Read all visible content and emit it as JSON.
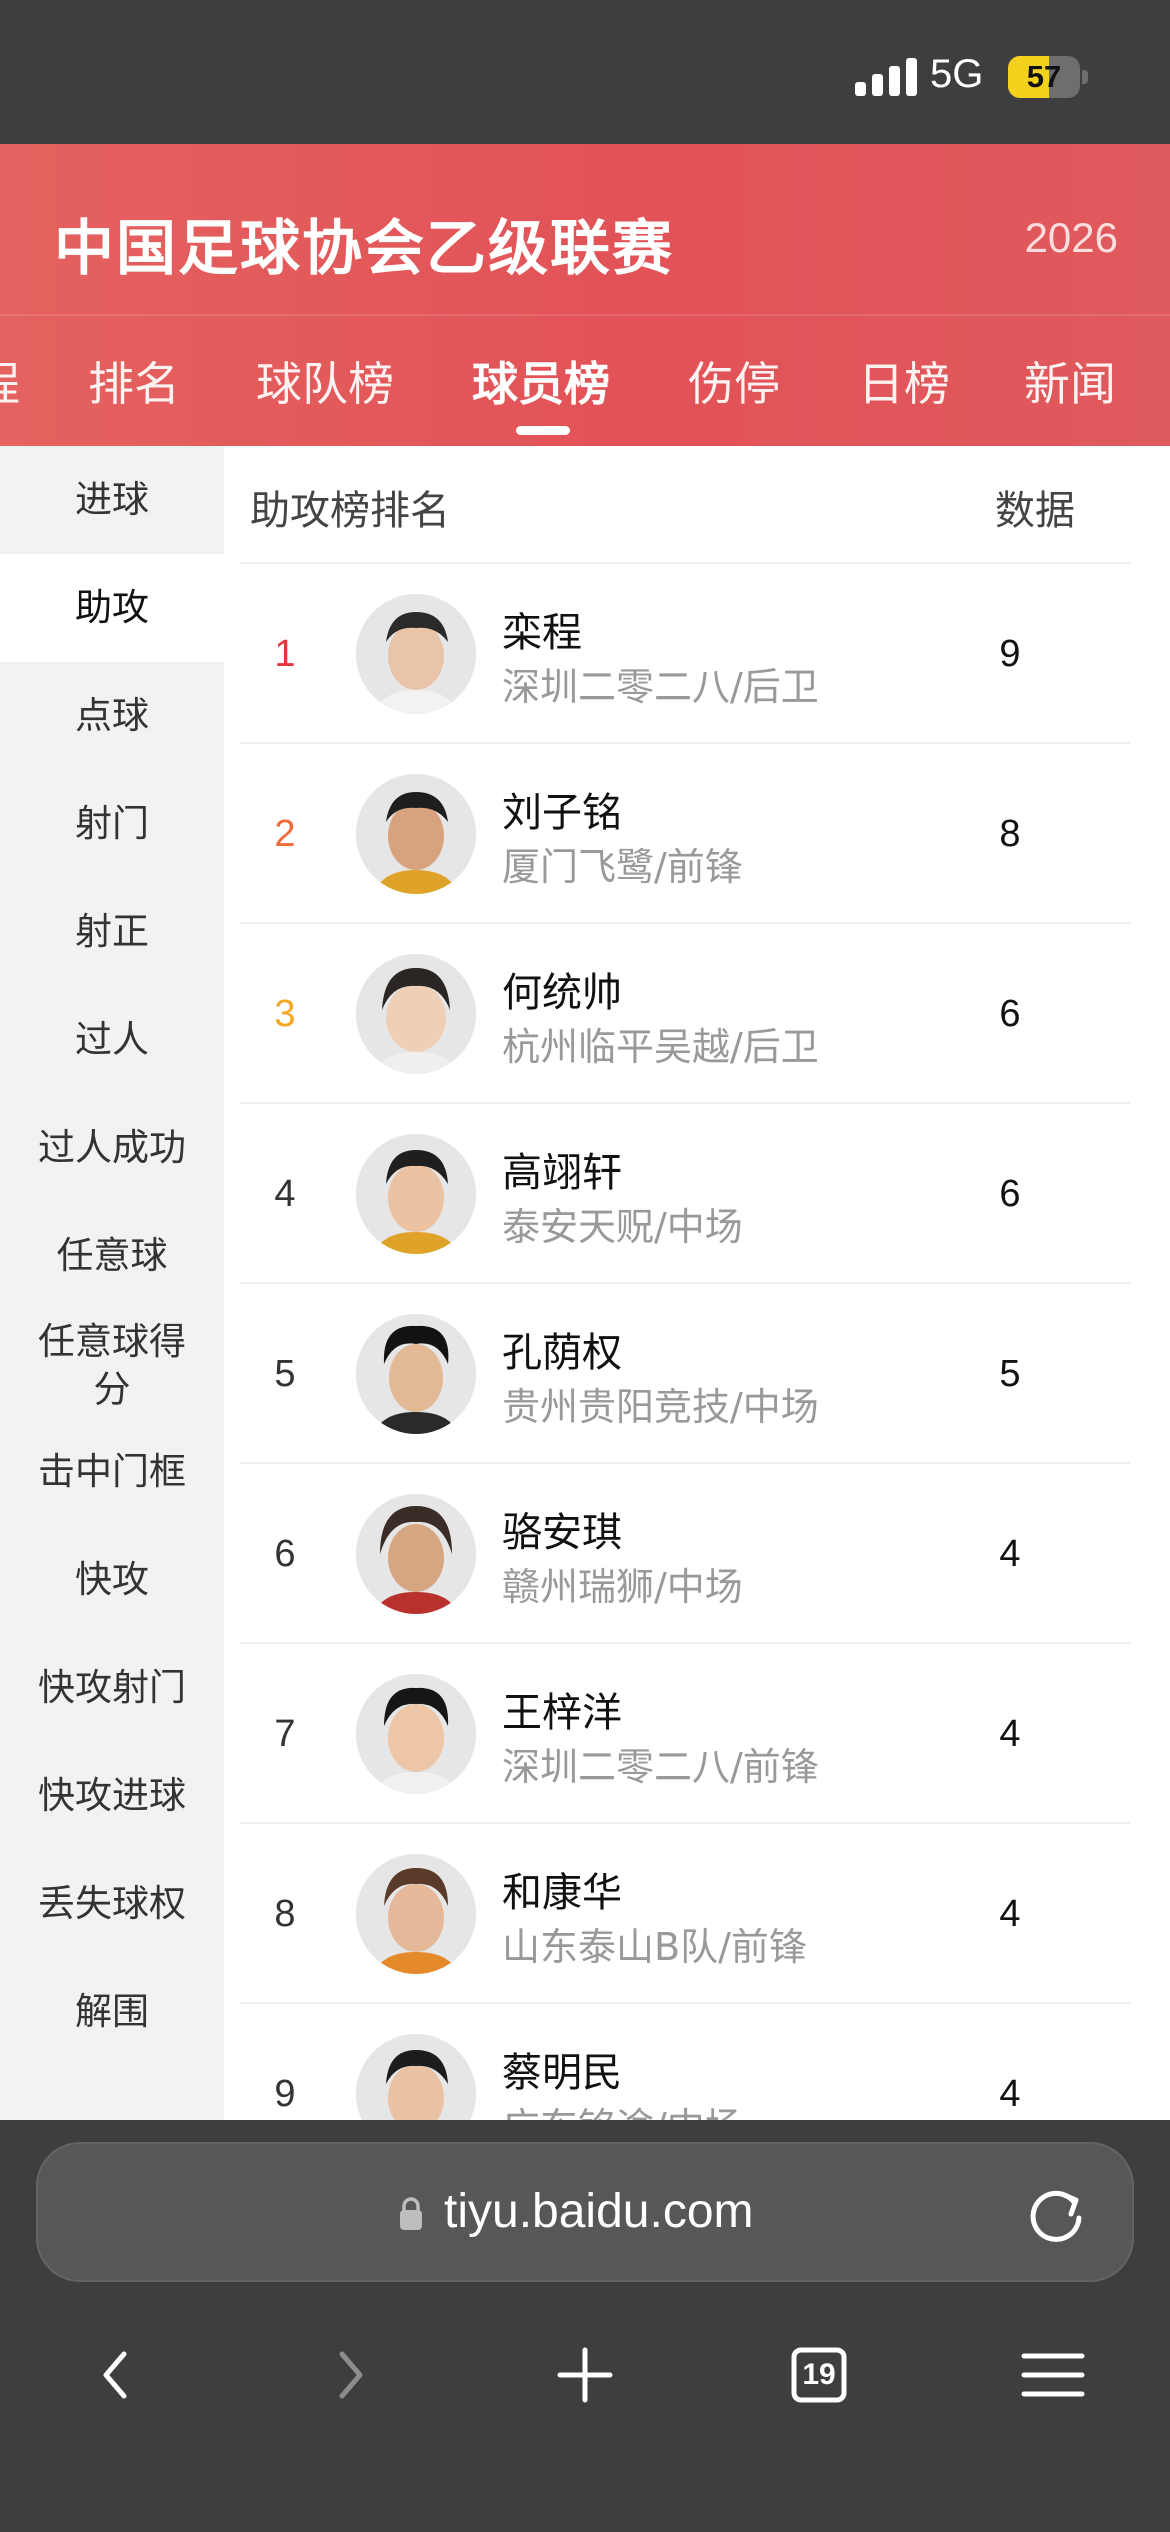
{
  "status_bar": {
    "network": "5G",
    "battery": 57
  },
  "header": {
    "title": "中国足球协会乙级联赛",
    "year": "2026"
  },
  "tabs": [
    {
      "label": "程"
    },
    {
      "label": "排名"
    },
    {
      "label": "球队榜"
    },
    {
      "label": "球员榜"
    },
    {
      "label": "伤停"
    },
    {
      "label": "日榜"
    },
    {
      "label": "新闻"
    }
  ],
  "active_tab": "球员榜",
  "sidebar": {
    "items": [
      {
        "label": "进球"
      },
      {
        "label": "助攻"
      },
      {
        "label": "点球"
      },
      {
        "label": "射门"
      },
      {
        "label": "射正"
      },
      {
        "label": "过人"
      },
      {
        "label": "过人成功"
      },
      {
        "label": "任意球"
      },
      {
        "label": "任意球得分"
      },
      {
        "label": "击中门框"
      },
      {
        "label": "快攻"
      },
      {
        "label": "快攻射门"
      },
      {
        "label": "快攻进球"
      },
      {
        "label": "丢失球权"
      },
      {
        "label": "解围"
      }
    ],
    "active": "助攻"
  },
  "list": {
    "header_label": "助攻榜排名",
    "header_data": "数据",
    "rows": [
      {
        "rank": "1",
        "name": "栾程",
        "team": "深圳二零二八/后卫",
        "value": "9"
      },
      {
        "rank": "2",
        "name": "刘子铭",
        "team": "厦门飞鹭/前锋",
        "value": "8"
      },
      {
        "rank": "3",
        "name": "何统帅",
        "team": "杭州临平吴越/后卫",
        "value": "6"
      },
      {
        "rank": "4",
        "name": "高翊轩",
        "team": "泰安天贶/中场",
        "value": "6"
      },
      {
        "rank": "5",
        "name": "孔荫权",
        "team": "贵州贵阳竞技/中场",
        "value": "5"
      },
      {
        "rank": "6",
        "name": "骆安琪",
        "team": "赣州瑞狮/中场",
        "value": "4"
      },
      {
        "rank": "7",
        "name": "王梓洋",
        "team": "深圳二零二八/前锋",
        "value": "4"
      },
      {
        "rank": "8",
        "name": "和康华",
        "team": "山东泰山B队/前锋",
        "value": "4"
      },
      {
        "rank": "9",
        "name": "蔡明民",
        "team": "广东铭途/中场",
        "value": "4"
      }
    ]
  },
  "rank_colors": {
    "1": "#e5343f",
    "2": "#f06a3a",
    "3": "#f5a623"
  },
  "browser": {
    "url": "tiyu.baidu.com",
    "tab_count": "19"
  },
  "icons": [
    "signal-icon",
    "battery-icon",
    "lock-icon",
    "reload-icon",
    "back-icon",
    "forward-icon",
    "add-tab-icon",
    "tabs-icon",
    "menu-icon"
  ]
}
